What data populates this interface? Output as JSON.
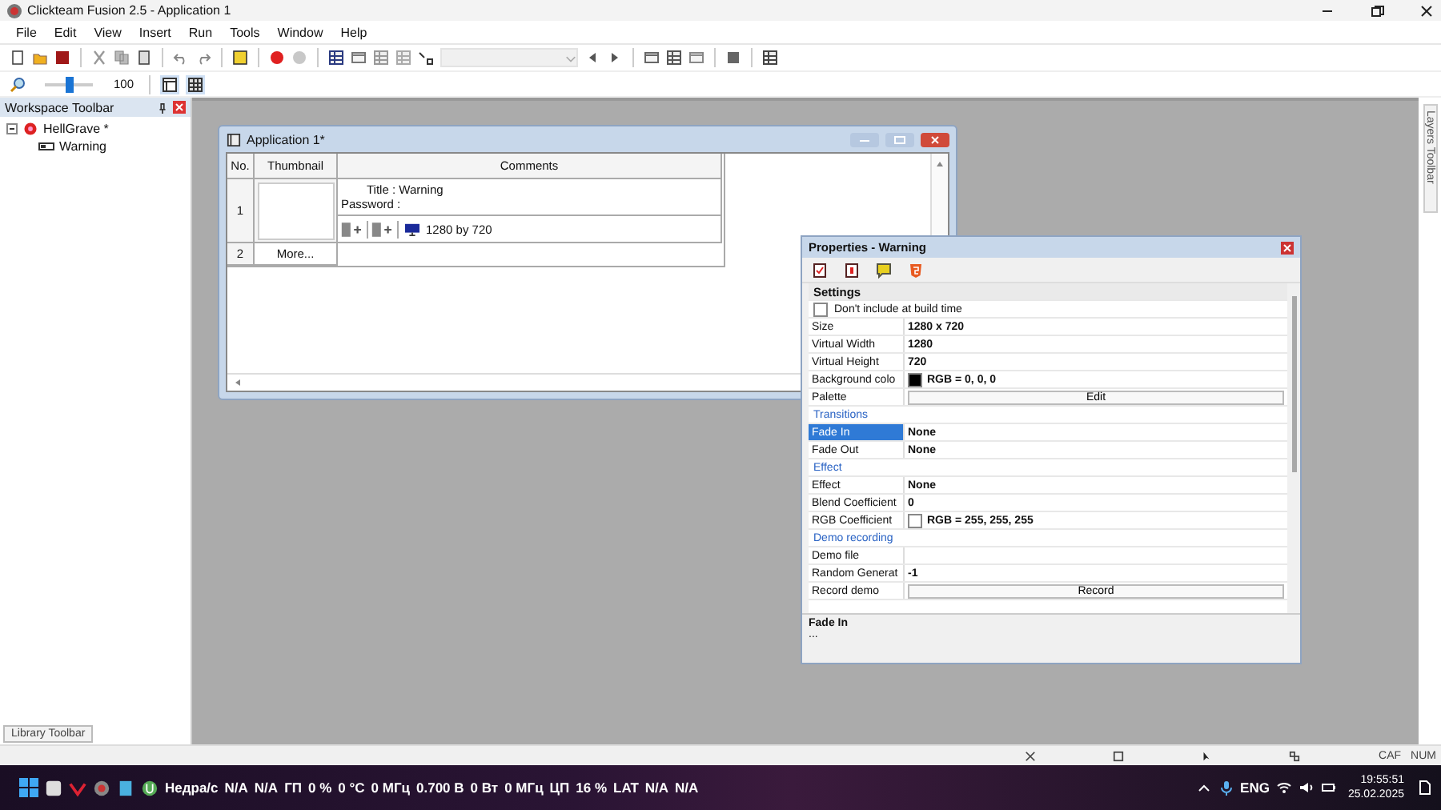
{
  "window": {
    "title": "Clickteam Fusion 2.5 - Application 1"
  },
  "menu": [
    "File",
    "Edit",
    "View",
    "Insert",
    "Run",
    "Tools",
    "Window",
    "Help"
  ],
  "zoom": {
    "level": 0.5,
    "value": "100"
  },
  "workspace": {
    "title": "Workspace Toolbar",
    "tree": [
      {
        "label": "HellGrave *",
        "expanded": true,
        "children": [
          {
            "label": "Warning"
          }
        ]
      }
    ]
  },
  "layers_toolbar": "Layers Toolbar",
  "app_window": {
    "title": "Application 1*",
    "columns": [
      "No.",
      "Thumbnail",
      "Comments"
    ],
    "frames": [
      {
        "no": "1",
        "title_label": "Title :",
        "title": "Warning",
        "password_label": "Password :",
        "size": "1280 by 720"
      }
    ],
    "more": {
      "no": "2",
      "label": "More..."
    }
  },
  "properties": {
    "title": "Properties - Warning",
    "rows": [
      {
        "kind": "header",
        "label": "Settings"
      },
      {
        "kind": "check",
        "label": "Don't include at build time",
        "checked": false
      },
      {
        "kind": "prop",
        "label": "Size",
        "value": "1280 x 720",
        "selected": false
      },
      {
        "kind": "prop",
        "label": "Virtual Width",
        "value": "1280",
        "selected": false
      },
      {
        "kind": "prop",
        "label": "Virtual Height",
        "value": "720",
        "selected": false
      },
      {
        "kind": "color",
        "label": "Background colo",
        "value": "RGB = 0, 0, 0",
        "color": "#000000",
        "selected": false
      },
      {
        "kind": "button",
        "label": "Palette",
        "value": "Edit",
        "selected": false
      },
      {
        "kind": "section",
        "label": "Transitions"
      },
      {
        "kind": "prop",
        "label": "Fade In",
        "value": "None",
        "selected": true
      },
      {
        "kind": "prop",
        "label": "Fade Out",
        "value": "None",
        "selected": false
      },
      {
        "kind": "section",
        "label": "Effect"
      },
      {
        "kind": "prop",
        "label": "Effect",
        "value": "None",
        "selected": false
      },
      {
        "kind": "prop",
        "label": "Blend Coefficient",
        "value": "0",
        "selected": false
      },
      {
        "kind": "color",
        "label": "RGB Coefficient",
        "value": "RGB = 255, 255, 255",
        "color": "#ffffff",
        "selected": false
      },
      {
        "kind": "section",
        "label": "Demo recording"
      },
      {
        "kind": "prop",
        "label": "Demo file",
        "selected": false
      },
      {
        "kind": "prop",
        "label": "Random Generat",
        "value": "-1",
        "selected": false
      },
      {
        "kind": "button",
        "label": "Record demo",
        "value": "Record",
        "selected": false
      }
    ],
    "description": {
      "title": "Fade In",
      "text": "..."
    }
  },
  "library_toolbar": "Library Toolbar",
  "status_bar": [
    "CAF",
    "NUM"
  ],
  "taskbar": {
    "widgets": [
      "Недра/с",
      "N/A",
      "N/A",
      "ГП",
      "0 %",
      "0 °C",
      "0 МГц",
      "0.700 В",
      "0 Вт",
      "0 МГц",
      "ЦП",
      "16 %",
      "LAT",
      "N/A",
      "N/A"
    ],
    "tray": {
      "lang": "ENG",
      "time": "19:55:51",
      "date": "25.02.2025"
    }
  }
}
